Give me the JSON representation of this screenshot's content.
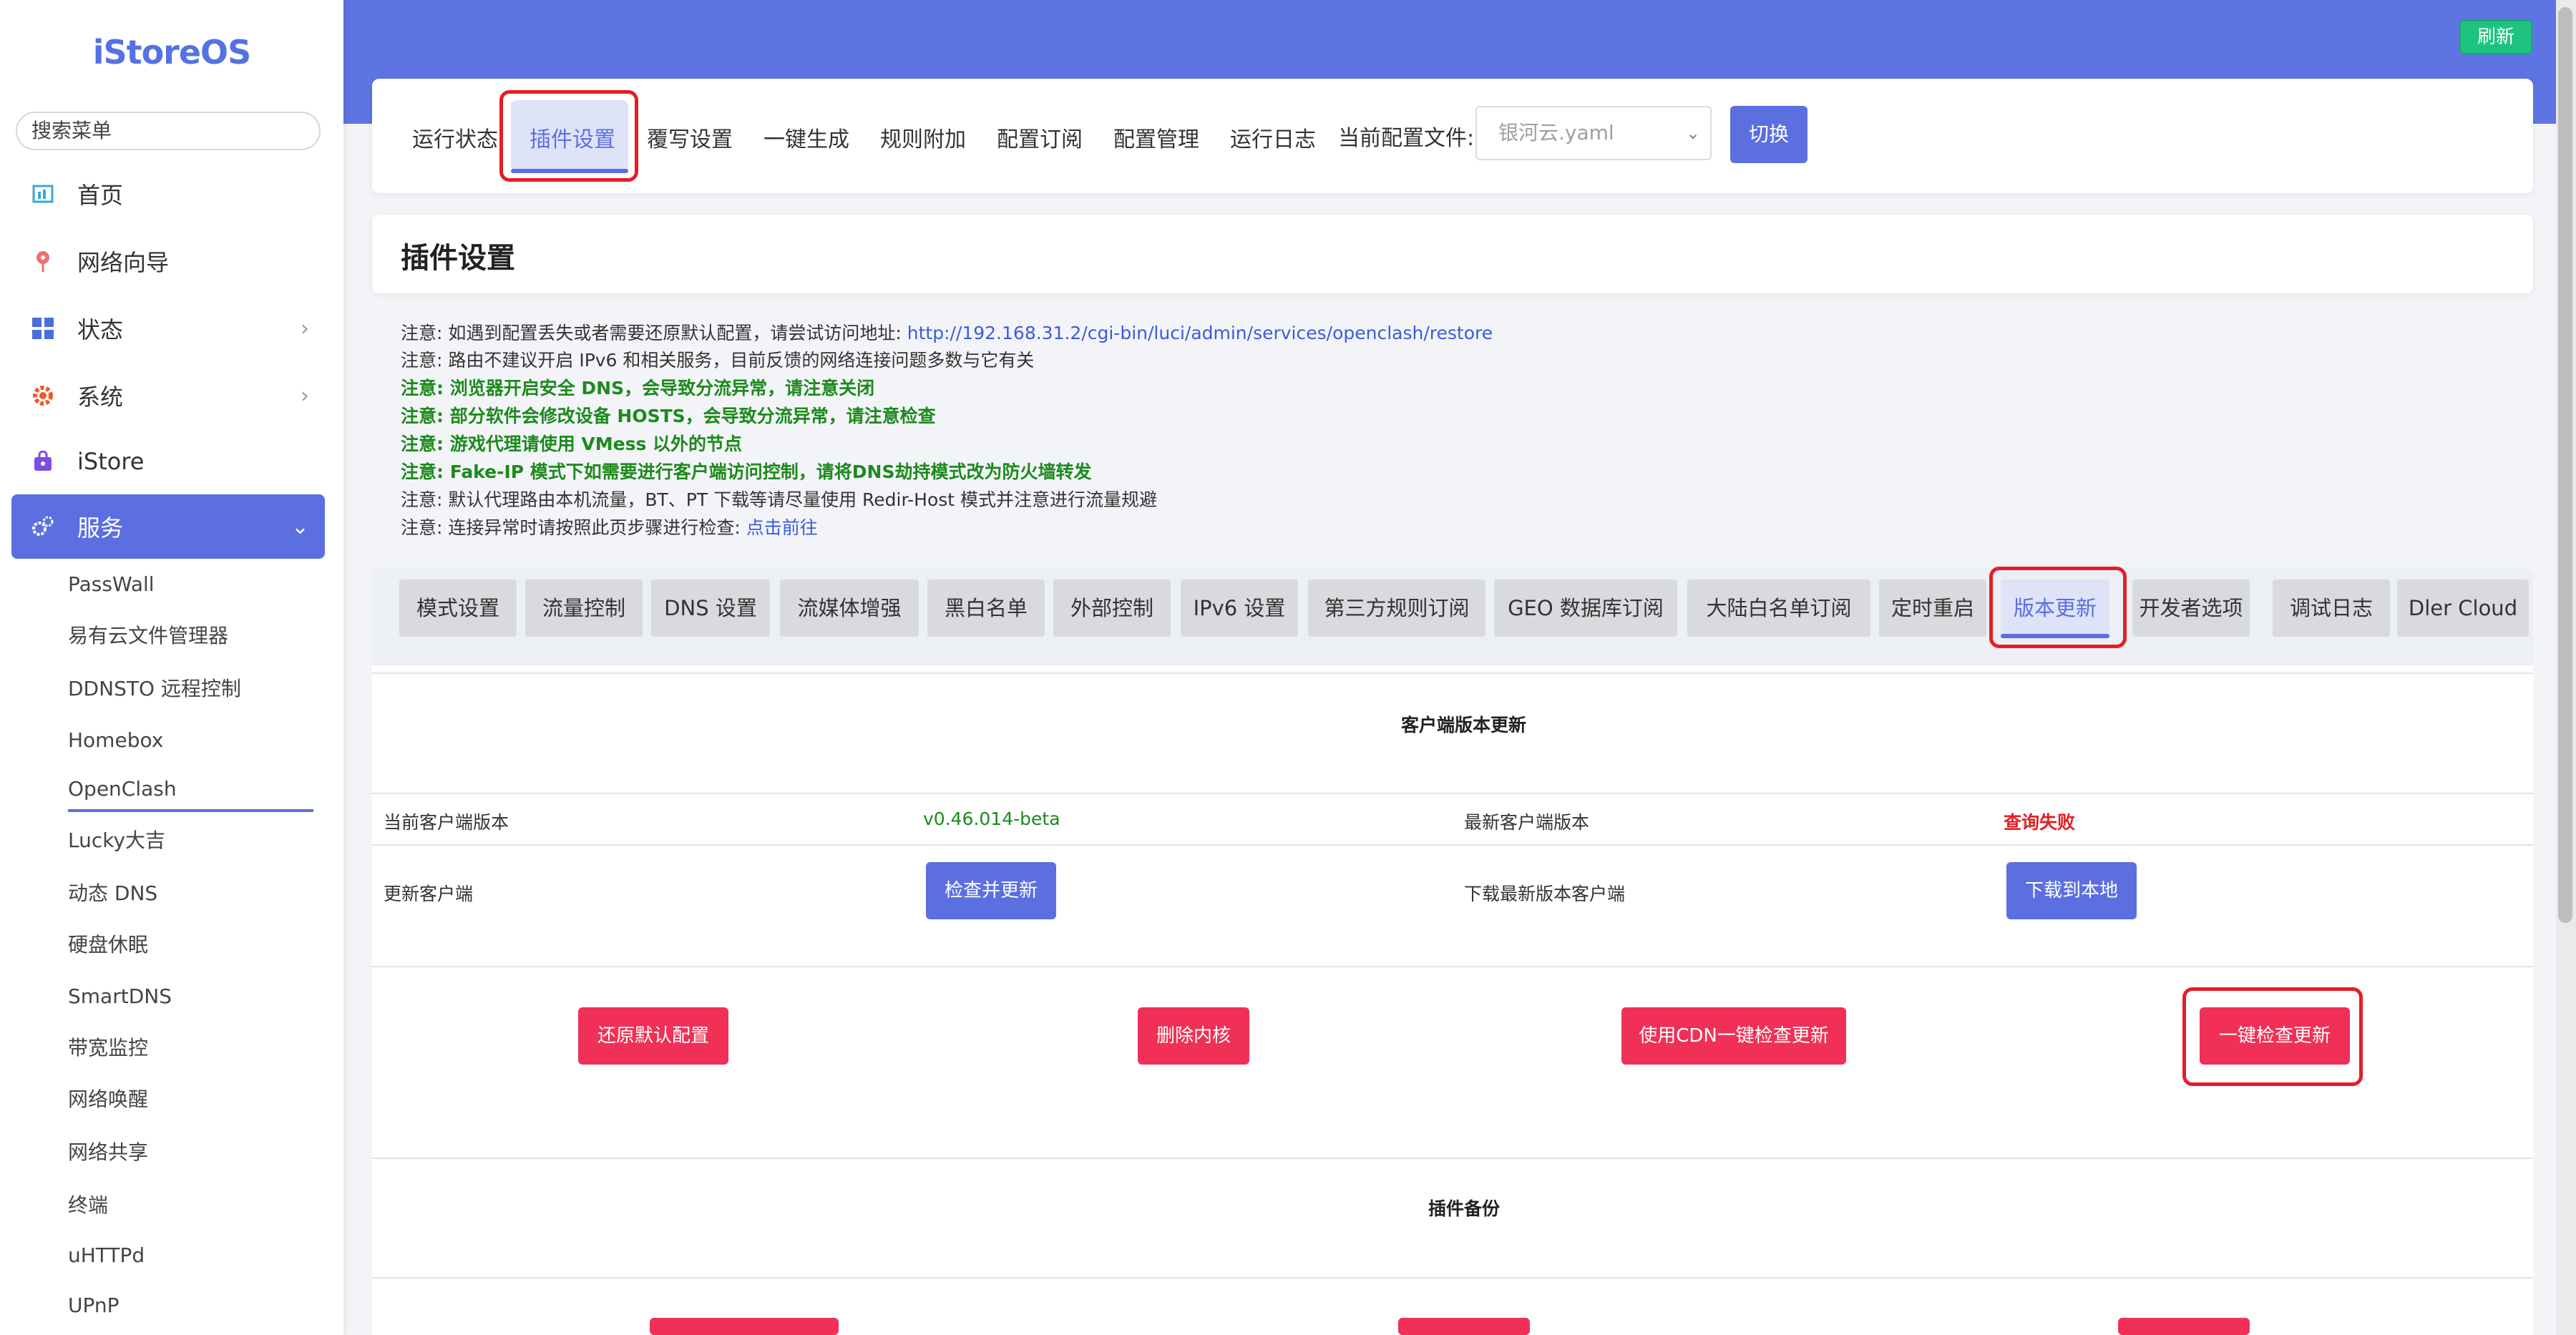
{
  "brand": "iStoreOS",
  "sidebar": {
    "search_placeholder": "搜索菜单",
    "items": [
      {
        "label": "首页"
      },
      {
        "label": "网络向导"
      },
      {
        "label": "状态"
      },
      {
        "label": "系统"
      },
      {
        "label": "iStore"
      },
      {
        "label": "服务"
      }
    ],
    "sub_items": [
      "PassWall",
      "易有云文件管理器",
      "DDNSTO 远程控制",
      "Homebox",
      "OpenClash",
      "Lucky大吉",
      "动态 DNS",
      "硬盘休眠",
      "SmartDNS",
      "带宽监控",
      "网络唤醒",
      "网络共享",
      "终端",
      "uHTTPd",
      "UPnP"
    ]
  },
  "header": {
    "refresh_label": "刷新"
  },
  "top_tabs": [
    "运行状态",
    "插件设置",
    "覆写设置",
    "一键生成",
    "规则附加",
    "配置订阅",
    "配置管理",
    "运行日志"
  ],
  "config": {
    "label": "当前配置文件:",
    "selected": "银河云.yaml",
    "switch_label": "切换"
  },
  "page_title": "插件设置",
  "notes": [
    {
      "text": "注意: 如遇到配置丢失或者需要还原默认配置，请尝试访问地址: ",
      "link": "http://192.168.31.2/cgi-bin/luci/admin/services/openclash/restore"
    },
    {
      "text": "注意: 路由不建议开启 IPv6 和相关服务，目前反馈的网络连接问题多数与它有关"
    },
    {
      "text": "注意: 浏览器开启安全 DNS，会导致分流异常，请注意关闭"
    },
    {
      "text": "注意: 部分软件会修改设备 HOSTS，会导致分流异常，请注意检查"
    },
    {
      "text": "注意: 游戏代理请使用 VMess 以外的节点"
    },
    {
      "text": "注意: Fake-IP 模式下如需要进行客户端访问控制，请将DNS劫持模式改为防火墙转发"
    },
    {
      "text": "注意: 默认代理路由本机流量，BT、PT 下载等请尽量使用 Redir-Host 模式并注意进行流量规避"
    },
    {
      "text": "注意: 连接异常时请按照此页步骤进行检查: ",
      "link": "点击前往"
    }
  ],
  "inner_tabs": [
    "模式设置",
    "流量控制",
    "DNS 设置",
    "流媒体增强",
    "黑白名单",
    "外部控制",
    "IPv6 设置",
    "第三方规则订阅",
    "GEO 数据库订阅",
    "大陆白名单订阅",
    "定时重启",
    "版本更新",
    "开发者选项",
    "调试日志",
    "Dler Cloud"
  ],
  "client_update": {
    "title": "客户端版本更新",
    "current_label": "当前客户端版本",
    "current_value": "v0.46.014-beta",
    "latest_label": "最新客户端版本",
    "latest_value": "查询失败",
    "update_label": "更新客户端",
    "check_update_btn": "检查并更新",
    "download_label": "下载最新版本客户端",
    "download_btn": "下载到本地"
  },
  "actions": {
    "restore_default": "还原默认配置",
    "delete_core": "删除内核",
    "cdn_check": "使用CDN一键检查更新",
    "one_click_check": "一键检查更新"
  },
  "backup": {
    "title": "插件备份"
  },
  "colors": {
    "accent": "#5b6fe0",
    "danger": "#f03056",
    "success": "#1c8a1c",
    "highlight": "#e41e26"
  }
}
